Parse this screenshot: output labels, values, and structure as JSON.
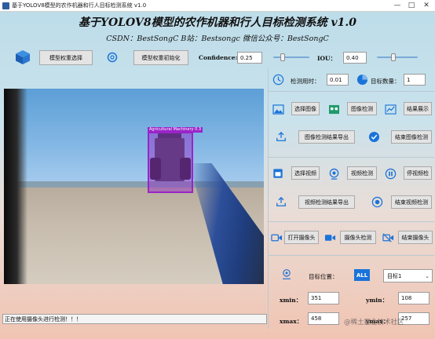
{
  "window": {
    "title": "基于YOLOV8模型的农作机器和行人目标检测系统 v1.0",
    "controls": [
      "—",
      "□",
      "✕"
    ]
  },
  "header": {
    "title": "基于YOLOV8模型的农作机器和行人目标检测系统 v1.0",
    "subtitle": "CSDN：BestSongC   B站：Bestsongc   微信公众号：BestSongC"
  },
  "toolbar": {
    "model_select_label": "模型权重选择",
    "model_init_label": "模型权重初始化",
    "confidence_label": "Confidence:",
    "confidence_value": "0.25",
    "confidence_level": 0.25,
    "iou_label": "IOU：",
    "iou_value": "0.40",
    "iou_level": 0.4
  },
  "stats": {
    "time_label": "检测用时：",
    "time_value": "0.01",
    "count_label": "目标数量：",
    "count_value": "1"
  },
  "image_section": {
    "select_label": "选择图像",
    "detect_label": "图像检测",
    "show_label": "结果展示",
    "export_label": "图像检测结果导出",
    "end_label": "结束图像检测"
  },
  "video_section": {
    "select_label": "选择视频",
    "detect_label": "视频检测",
    "pause_label": "停视频检",
    "export_label": "视频检测结果导出",
    "end_label": "结束视频检测"
  },
  "camera_section": {
    "open_label": "打开摄像头",
    "detect_label": "摄像头检测",
    "end_label": "结束摄像头"
  },
  "target": {
    "position_label": "目标位置：",
    "all_badge": "ALL",
    "selected_target": "目标1",
    "xmin_label": "xmin：",
    "xmin_value": "351",
    "ymin_label": "ymin：",
    "ymin_value": "108",
    "xmax_label": "xmax：",
    "xmax_value": "458",
    "ymax_label": "ymax：",
    "ymax_value": "257"
  },
  "detection": {
    "label": "Agricultural Machinery 0.3"
  },
  "status": {
    "message": "正在使用摄像头进行检测！！！"
  },
  "watermark": "@稀土掘金技术社区",
  "colors": {
    "accent_blue": "#1a73d9",
    "bbox_purple": "#9a24c8"
  }
}
